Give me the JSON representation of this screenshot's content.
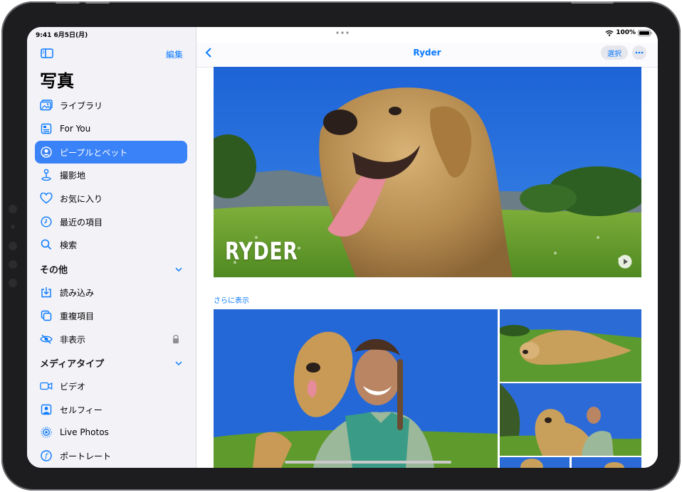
{
  "status": {
    "time_date": "9:41 6月5日(月)",
    "battery": "100%"
  },
  "sidebar": {
    "edit_label": "編集",
    "title": "写真",
    "items": [
      {
        "label": "ライブラリ",
        "icon": "photo-library-icon"
      },
      {
        "label": "For You",
        "icon": "for-you-icon"
      },
      {
        "label": "ピープルとペット",
        "icon": "person-circle-icon",
        "active": true
      },
      {
        "label": "撮影地",
        "icon": "map-pin-icon"
      },
      {
        "label": "お気に入り",
        "icon": "heart-icon"
      },
      {
        "label": "最近の項目",
        "icon": "clock-icon"
      },
      {
        "label": "検索",
        "icon": "search-icon"
      }
    ],
    "section_other": "その他",
    "other_items": [
      {
        "label": "読み込み",
        "icon": "import-icon"
      },
      {
        "label": "重複項目",
        "icon": "duplicates-icon"
      },
      {
        "label": "非表示",
        "icon": "eye-slash-icon",
        "locked": true
      }
    ],
    "section_media": "メディアタイプ",
    "media_items": [
      {
        "label": "ビデオ",
        "icon": "video-icon"
      },
      {
        "label": "セルフィー",
        "icon": "selfie-icon"
      },
      {
        "label": "Live Photos",
        "icon": "live-photos-icon"
      },
      {
        "label": "ポートレート",
        "icon": "portrait-icon"
      }
    ]
  },
  "main": {
    "title": "Ryder",
    "select_label": "選択",
    "hero_title": "RYDER",
    "more_link": "さらに表示"
  },
  "colors": {
    "accent": "#0a7aff",
    "active_row": "#3a82f7",
    "sidebar_bg": "#f2f2f7"
  }
}
